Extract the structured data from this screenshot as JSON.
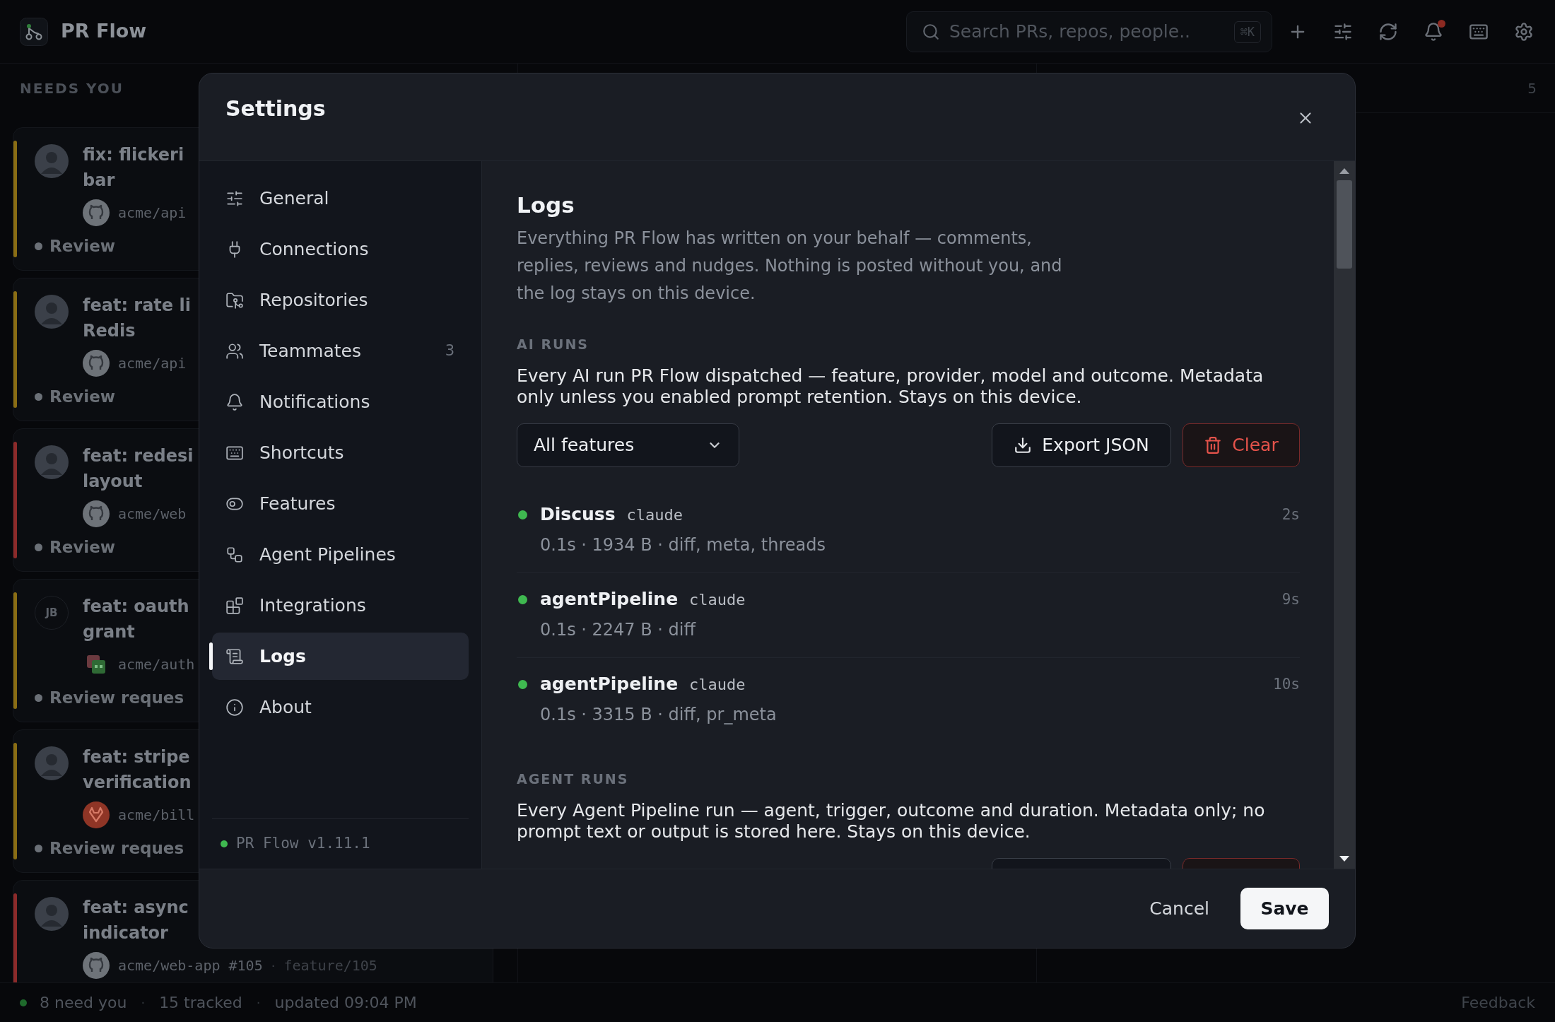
{
  "app": {
    "name": "PR Flow"
  },
  "search": {
    "placeholder": "Search PRs, repos, people..",
    "shortcut": "⌘K"
  },
  "notifications": {
    "unread": true
  },
  "board": {
    "column_1": {
      "title": "NEEDS YOU",
      "cards": [
        {
          "title_lines": [
            "fix: flickeri",
            "bar"
          ],
          "color": "#8a6d14",
          "repo": "acme/api",
          "status": "Review"
        },
        {
          "title_lines": [
            "feat: rate li",
            "Redis"
          ],
          "color": "#8a6d14",
          "repo": "acme/api",
          "status": "Review"
        },
        {
          "title_lines": [
            "feat: redesi",
            "layout"
          ],
          "color": "#8c2a2a",
          "repo": "acme/web",
          "status": "Review"
        },
        {
          "title_lines": [
            "feat: oauth",
            "grant"
          ],
          "color": "#8a6d14",
          "initials": "JB",
          "repo": "acme/auth",
          "status": "Review reques"
        },
        {
          "title_lines": [
            "feat: stripe",
            "verification"
          ],
          "color": "#8a6d14",
          "repo": "acme/bill",
          "status": "Review reques"
        },
        {
          "title_lines": [
            "feat: async",
            "indicator"
          ],
          "color": "#8c2a2a",
          "repo": "acme/web-app #105",
          "branch_separator": "·",
          "branch": "feature/105"
        }
      ]
    },
    "column_3": {
      "count": "5"
    }
  },
  "status_bar": {
    "items": [
      "8 need you",
      "15 tracked",
      "updated 09:04 PM"
    ],
    "separators": [
      "·",
      "·"
    ],
    "feedback": "Feedback"
  },
  "settings": {
    "title": "Settings",
    "nav": [
      {
        "label": "General",
        "selected": false
      },
      {
        "label": "Connections",
        "selected": false
      },
      {
        "label": "Repositories",
        "selected": false
      },
      {
        "label": "Teammates",
        "selected": false,
        "count": "3"
      },
      {
        "label": "Notifications",
        "selected": false
      },
      {
        "label": "Shortcuts",
        "selected": false
      },
      {
        "label": "Features",
        "selected": false
      },
      {
        "label": "Agent Pipelines",
        "selected": false
      },
      {
        "label": "Integrations",
        "selected": false
      },
      {
        "label": "Logs",
        "selected": true
      },
      {
        "label": "About",
        "selected": false
      }
    ],
    "version": "PR Flow v1.11.1",
    "page": {
      "title": "Logs",
      "description": "Everything PR Flow has written on your behalf — comments, replies, reviews and nudges. Nothing is posted without you, and the log stays on this device.",
      "sections": [
        {
          "heading": "AI RUNS",
          "description": "Every AI run PR Flow dispatched — feature, provider, model and outcome. Metadata only unless you enabled prompt retention. Stays on this device.",
          "filter": "All features",
          "export": "Export JSON",
          "clear": "Clear",
          "runs": [
            {
              "name": "Discuss",
              "provider": "claude",
              "details": "0.1s · 1934 B · diff, meta, threads",
              "age": "2s",
              "color": "#3fb950"
            },
            {
              "name": "agentPipeline",
              "provider": "claude",
              "details": "0.1s · 2247 B · diff",
              "age": "9s",
              "color": "#3fb950"
            },
            {
              "name": "agentPipeline",
              "provider": "claude",
              "details": "0.1s · 3315 B · diff, pr_meta",
              "age": "10s",
              "color": "#3fb950"
            }
          ]
        },
        {
          "heading": "AGENT RUNS",
          "description": "Every Agent Pipeline run — agent, trigger, outcome and duration. Metadata only; no prompt text or output is stored here. Stays on this device."
        }
      ]
    },
    "buttons": {
      "cancel": "Cancel",
      "save": "Save"
    }
  }
}
